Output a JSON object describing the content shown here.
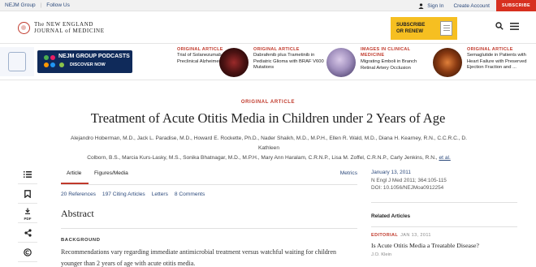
{
  "utility": {
    "group": "NEJM Group",
    "follow": "Follow Us",
    "signin": "Sign In",
    "create": "Create Account",
    "subscribe": "SUBSCRIBE"
  },
  "header": {
    "logo_line1": "The NEW ENGLAND",
    "logo_line2": "JOURNAL of MEDICINE",
    "cta_line1": "SUBSCRIBE",
    "cta_line2": "OR RENEW"
  },
  "promo": {
    "title": "NEJM GROUP PODCASTS",
    "cta": "DISCOVER NOW"
  },
  "teasers": [
    {
      "kind": "ORIGINAL ARTICLE",
      "title": "Trial of Solanezumab in Preclinical Alzheimer's Disease"
    },
    {
      "kind": "ORIGINAL ARTICLE",
      "title": "Dabrafenib plus Trametinib in Pediatric Glioma with BRAF V600 Mutations"
    },
    {
      "kind": "IMAGES IN CLINICAL MEDICINE",
      "title": "Migrating Emboli in Branch Retinal Artery Occlusion"
    },
    {
      "kind": "ORIGINAL ARTICLE",
      "title": "Semaglutide in Patients with Heart Failure with Preserved Ejection Fraction and ..."
    }
  ],
  "article": {
    "kicker": "ORIGINAL ARTICLE",
    "title": "Treatment of Acute Otitis Media in Children under 2 Years of Age",
    "authors_line1": "Alejandro Hoberman, M.D., Jack L. Paradise, M.D., Howard E. Rockette, Ph.D., Nader Shaikh, M.D., M.P.H., Ellen R. Wald, M.D., Diana H. Kearney, R.N., C.C.R.C., D. Kathleen",
    "authors_line2": "Colborn, B.S., Marcia Kurs-Lasky, M.S., Sonika Bhatnagar, M.D., M.P.H., Mary Ann Haralam, C.R.N.P., Lisa M. Zoffel, C.R.N.P., Carly Jenkins, R.N.,",
    "etal": "et al."
  },
  "toolbar": {
    "pdf_label": "PDF"
  },
  "tabs": {
    "article": "Article",
    "figures": "Figures/Media",
    "metrics": "Metrics"
  },
  "links": [
    {
      "count": "20",
      "label": "References"
    },
    {
      "count": "197",
      "label": "Citing Articles"
    },
    {
      "count": "",
      "label": "Letters"
    },
    {
      "count": "8",
      "label": "Comments"
    }
  ],
  "abstract": {
    "heading": "Abstract",
    "section": "BACKGROUND",
    "text": "Recommendations vary regarding immediate antimicrobial treatment versus watchful waiting for children younger than 2 years of age with acute otitis media."
  },
  "meta": {
    "date": "January 13, 2011",
    "citation": "N Engl J Med 2011; 364:105-115",
    "doi": "DOI: 10.1056/NEJMoa0912254"
  },
  "related": {
    "heading": "Related Articles",
    "kind": "EDITORIAL",
    "date": "JAN 13, 2011",
    "title": "Is Acute Otitis Media a Treatable Disease?",
    "author": "J.O. Klein"
  }
}
